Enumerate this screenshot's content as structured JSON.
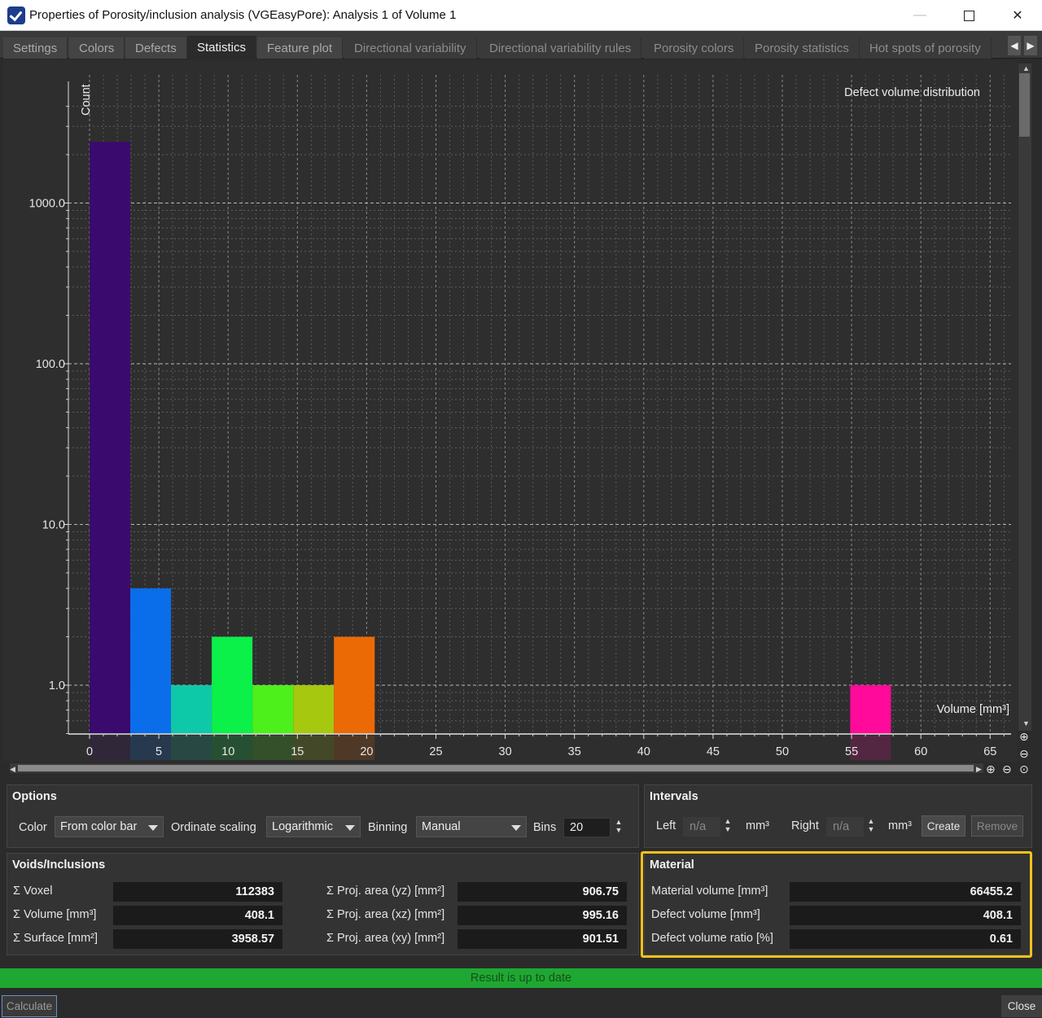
{
  "window": {
    "title": "Properties of Porosity/inclusion analysis (VGEasyPore): Analysis 1 of Volume 1"
  },
  "tabs": [
    {
      "label": "Settings"
    },
    {
      "label": "Colors"
    },
    {
      "label": "Defects"
    },
    {
      "label": "Statistics"
    },
    {
      "label": "Feature plot"
    },
    {
      "label": "Directional variability"
    },
    {
      "label": "Directional variability rules"
    },
    {
      "label": "Porosity colors"
    },
    {
      "label": "Porosity statistics"
    },
    {
      "label": "Hot spots of porosity"
    }
  ],
  "active_tab": "Statistics",
  "chart_data": {
    "type": "bar",
    "title": "Defect volume distribution",
    "xlabel": "Volume [mm³]",
    "ylabel": "Count",
    "yscale": "log",
    "xlim": [
      0,
      66
    ],
    "ylim": [
      0.5,
      4500
    ],
    "x_ticks": [
      0,
      5,
      10,
      15,
      20,
      25,
      30,
      35,
      40,
      45,
      50,
      55,
      60,
      65
    ],
    "y_tick_labels": [
      "1000.0",
      "100.0",
      "10.0",
      "1.0"
    ],
    "y_tick_values": [
      1000,
      100,
      10,
      1
    ],
    "grid": true,
    "bars": [
      {
        "x0": 0.0,
        "x1": 2.94,
        "count": 2400,
        "color": "#3b0a6e"
      },
      {
        "x0": 2.94,
        "x1": 5.88,
        "count": 4,
        "color": "#0a6eea"
      },
      {
        "x0": 5.88,
        "x1": 8.82,
        "count": 1,
        "color": "#0ec9a8"
      },
      {
        "x0": 8.82,
        "x1": 11.76,
        "count": 2,
        "color": "#0cf04a"
      },
      {
        "x0": 11.76,
        "x1": 14.7,
        "count": 1,
        "color": "#4ef01c"
      },
      {
        "x0": 14.7,
        "x1": 17.64,
        "count": 1,
        "color": "#a6c80e"
      },
      {
        "x0": 17.64,
        "x1": 20.58,
        "count": 2,
        "color": "#ec6a06"
      },
      {
        "x0": 54.9,
        "x1": 57.84,
        "count": 1,
        "color": "#ff0a9a"
      }
    ]
  },
  "options": {
    "title": "Options",
    "color_label": "Color",
    "color_value": "From color bar",
    "ordinate_label": "Ordinate scaling",
    "ordinate_value": "Logarithmic",
    "binning_label": "Binning",
    "binning_value": "Manual",
    "bins_label": "Bins",
    "bins_value": "20"
  },
  "intervals": {
    "title": "Intervals",
    "left_label": "Left",
    "left_value": "n/a",
    "left_unit": "mm³",
    "right_label": "Right",
    "right_value": "n/a",
    "right_unit": "mm³",
    "create_label": "Create",
    "remove_label": "Remove"
  },
  "voids": {
    "title": "Voids/Inclusions",
    "rows": [
      {
        "label": "Σ Voxel",
        "value": "112383"
      },
      {
        "label": "Σ Volume [mm³]",
        "value": "408.1"
      },
      {
        "label": "Σ Surface [mm²]",
        "value": "3958.57"
      }
    ],
    "proj_rows": [
      {
        "label": "Σ Proj. area (yz) [mm²]",
        "value": "906.75"
      },
      {
        "label": "Σ Proj. area (xz) [mm²]",
        "value": "995.16"
      },
      {
        "label": "Σ Proj. area (xy) [mm²]",
        "value": "901.51"
      }
    ]
  },
  "material": {
    "title": "Material",
    "rows": [
      {
        "label": "Material volume [mm³]",
        "value": "66455.2"
      },
      {
        "label": "Defect volume [mm³]",
        "value": "408.1"
      },
      {
        "label": "Defect volume ratio [%]",
        "value": "0.61"
      }
    ]
  },
  "status": "Result is up to date",
  "buttons": {
    "calculate": "Calculate",
    "close": "Close"
  }
}
